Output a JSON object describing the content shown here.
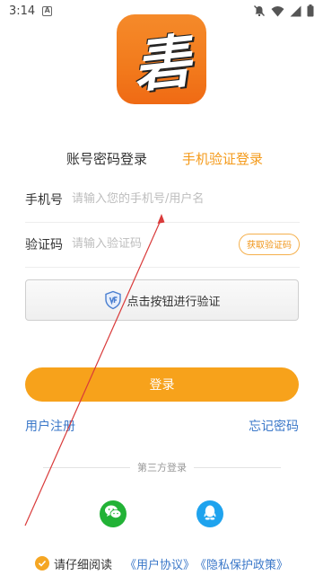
{
  "status_bar": {
    "time": "3:14",
    "notif_letter": "A"
  },
  "logo": {
    "glyph": "砉"
  },
  "tabs": {
    "account": "账号密码登录",
    "phone": "手机验证登录"
  },
  "form": {
    "phone_label": "手机号",
    "phone_placeholder": "请输入您的手机号/用户名",
    "code_label": "验证码",
    "code_placeholder": "请输入验证码",
    "get_code": "获取验证码"
  },
  "verify": {
    "label": "点击按钮进行验证"
  },
  "login": {
    "label": "登录"
  },
  "links": {
    "register": "用户注册",
    "forgot": "忘记密码"
  },
  "third_party": {
    "title": "第三方登录"
  },
  "agreement": {
    "prefix": "请仔细阅读",
    "user_agreement": "《用户协议》",
    "privacy": "《隐私保护政策》"
  },
  "colors": {
    "accent": "#f7a21b",
    "link": "#3b78c9",
    "wechat": "#22b236",
    "qq": "#1fa3ee",
    "annotation": "#d93a3a"
  }
}
